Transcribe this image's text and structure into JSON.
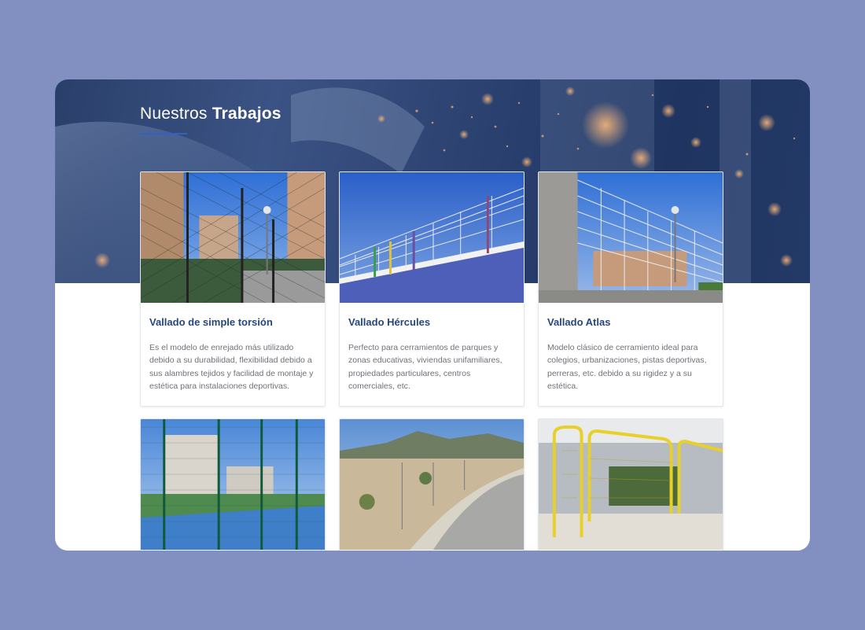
{
  "section": {
    "title_light": "Nuestros",
    "title_bold": "Trabajos",
    "accent_color": "#2f62c7",
    "hero_color": "#2b4170",
    "background_color": "#8190c0"
  },
  "cards": [
    {
      "title": "Vallado de simple torsión",
      "description": "Es el modelo de enrejado más utilizado debido a su durabilidad, flexibilidad debido a sus alambres tejidos y facilidad de montaje y estética para instalaciones deportivas.",
      "image": "tennis-court-chain-link-fence-photo"
    },
    {
      "title": "Vallado Hércules",
      "description": "Perfecto para cerramientos de parques y zonas educativas, viviendas unifamiliares, propiedades particulares, centros comerciales, etc.",
      "image": "welded-mesh-panel-fence-photo"
    },
    {
      "title": "Vallado Atlas",
      "description": "Modelo clásico de cerramiento ideal para colegios, urbanizaciones, pistas deportivas, perreras, etc. debido a su rigidez y a su estética.",
      "image": "atlas-mesh-fence-photo"
    },
    {
      "image": "sports-court-green-fence-photo"
    },
    {
      "image": "roadside-fence-hills-photo"
    },
    {
      "image": "yellow-barrier-fence-photo"
    }
  ]
}
